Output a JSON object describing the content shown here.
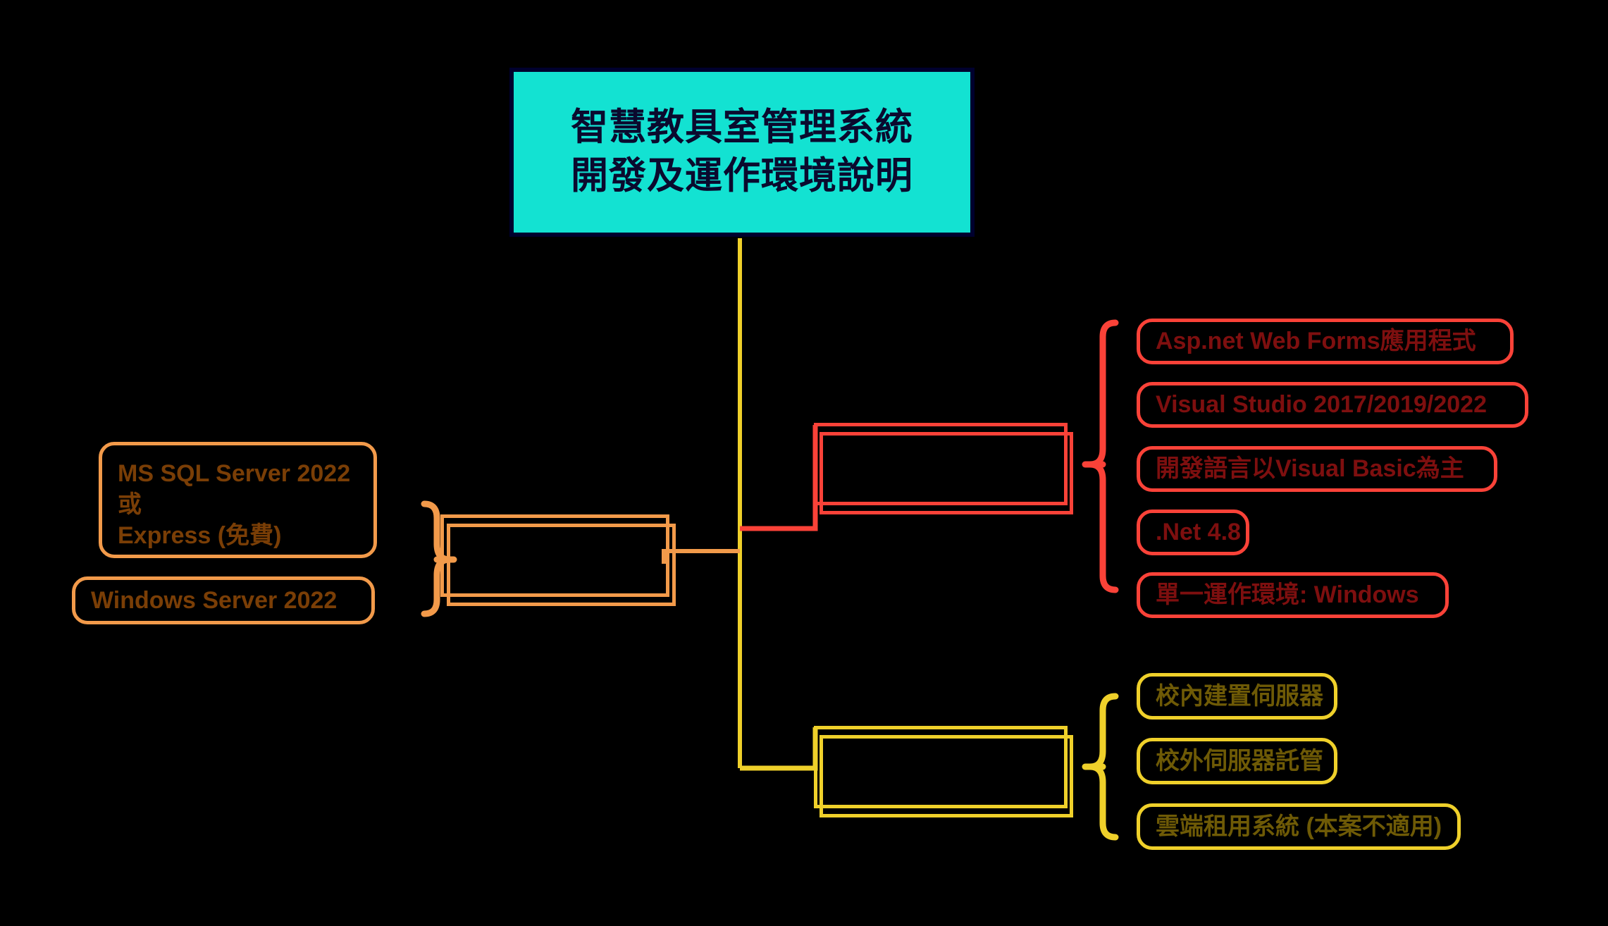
{
  "diagram": {
    "type": "mindmap",
    "background_color": "#000000",
    "root": {
      "title_line_1": "智慧教具室管理系統",
      "title_line_2": "開發及運作環境說明",
      "fill_color": "#13E2D2",
      "text_color": "#0A0A2E",
      "border_color": "#00002E"
    },
    "branches": [
      {
        "id": "dev",
        "color": "#FA4238",
        "text_color": "#7E0F0F",
        "hub_label": "",
        "side": "right",
        "items": [
          {
            "label": "Asp.net Web Forms應用程式"
          },
          {
            "label": "Visual Studio 2017/2019/2022"
          },
          {
            "label": "開發語言以Visual Basic為主"
          },
          {
            "label": ".Net 4.8"
          },
          {
            "label": "單一運作環境: Windows"
          }
        ]
      },
      {
        "id": "server-db",
        "color": "#F29A4A",
        "text_color": "#7A3E06",
        "hub_label": "",
        "side": "left",
        "items": [
          {
            "label": "MS SQL Server 2022\n或\nExpress (免費)"
          },
          {
            "label": "Windows Server 2022"
          }
        ]
      },
      {
        "id": "hosting",
        "color": "#EFD02A",
        "text_color": "#6E5A06",
        "hub_label": "",
        "side": "right",
        "items": [
          {
            "label": "校內建置伺服器"
          },
          {
            "label": "校外伺服器託管"
          },
          {
            "label": "雲端租用系統 (本案不適用)"
          }
        ]
      }
    ]
  }
}
